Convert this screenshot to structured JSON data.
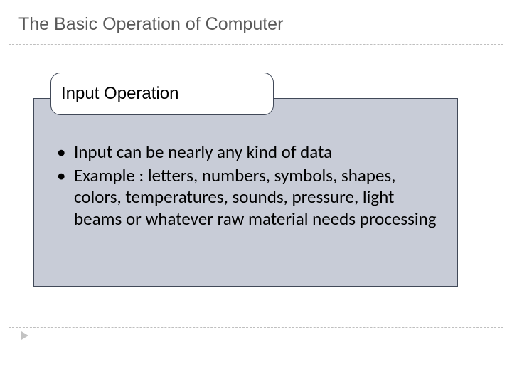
{
  "title": "The Basic Operation of Computer",
  "card": {
    "label": "Input Operation",
    "bullets": [
      "Input can be nearly any kind of data",
      "Example : letters, numbers, symbols, shapes, colors, temperatures, sounds, pressure, light beams or whatever raw material needs processing"
    ]
  }
}
